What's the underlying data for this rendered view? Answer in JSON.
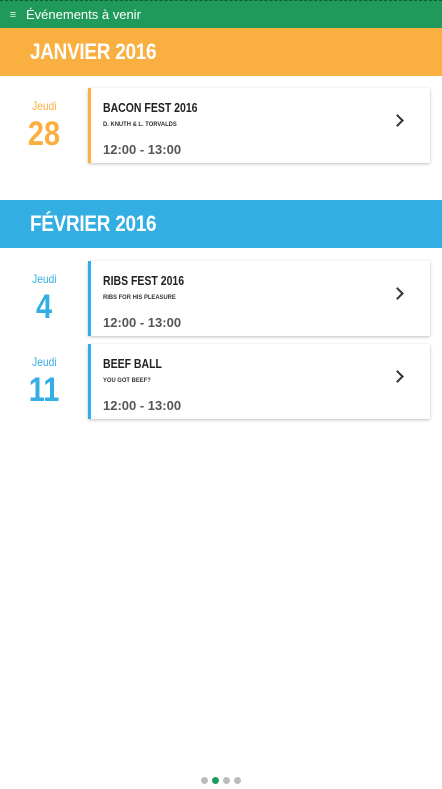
{
  "header": {
    "title": "Événements à venir",
    "menu_icon": "≡"
  },
  "colors": {
    "green": "#1f9a5a",
    "orange": "#f9b040",
    "blue": "#33aee3"
  },
  "months": [
    {
      "label": "JANVIER 2016",
      "events": [
        {
          "dow": "Jeudi",
          "day": "28",
          "title": "BACON FEST 2016",
          "subtitle": "D. KNUTH & L. TORVALDS",
          "time": "12:00 - 13:00"
        }
      ]
    },
    {
      "label": "FÉVRIER 2016",
      "events": [
        {
          "dow": "Jeudi",
          "day": "4",
          "title": "RIBS FEST 2016",
          "subtitle": "RIBS FOR HIS PLEASURE",
          "time": "12:00 - 13:00"
        },
        {
          "dow": "Jeudi",
          "day": "11",
          "title": "BEEF BALL",
          "subtitle": "YOU GOT BEEF?",
          "time": "12:00 - 13:00"
        }
      ]
    }
  ],
  "pager": {
    "count": 4,
    "active_index": 1
  }
}
